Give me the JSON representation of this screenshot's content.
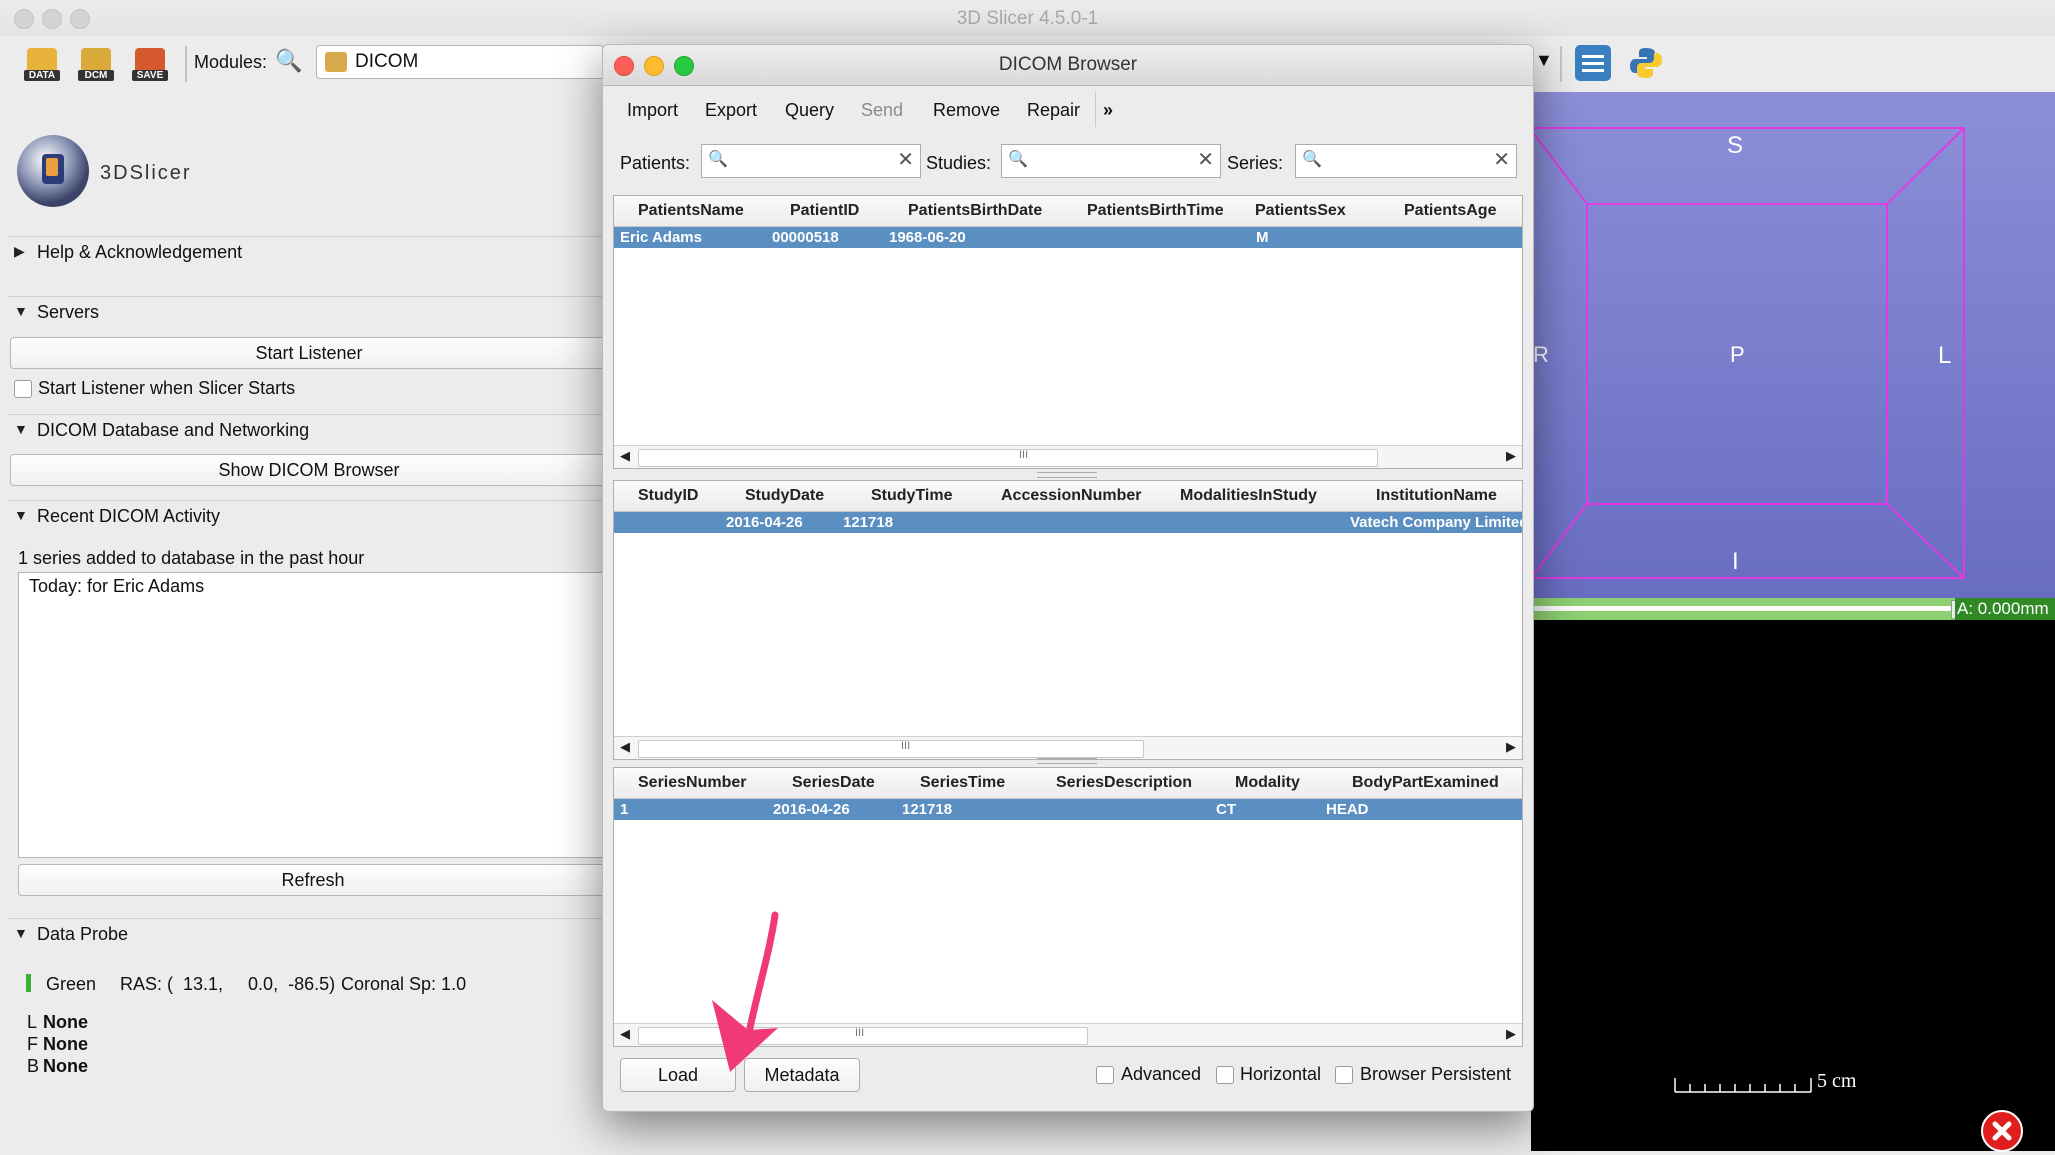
{
  "app": {
    "window_title": "3D Slicer 4.5.0-1"
  },
  "toolbar": {
    "data_label": "DATA",
    "dcm_label": "DCM",
    "save_label": "SAVE",
    "modules_label": "Modules:",
    "module_selected": "DICOM"
  },
  "left": {
    "logo_text": "3DSlicer",
    "help_section": "Help & Acknowledgement",
    "servers_section": "Servers",
    "start_listener": "Start Listener",
    "start_listener_checkbox": "Start Listener when Slicer Starts",
    "db_section": "DICOM Database and Networking",
    "show_browser": "Show DICOM Browser",
    "recent_section": "Recent DICOM Activity",
    "recent_summary": "1 series added to database in the past hour",
    "recent_entry": "Today:  for Eric Adams",
    "refresh": "Refresh",
    "probe_section": "Data Probe",
    "probe_view": "Green",
    "probe_ras": "RAS: (  13.1,     0.0,  -86.5)",
    "probe_orient": "Coronal Sp: 1.0",
    "probe_l_key": "L",
    "probe_l_val": "None",
    "probe_f_key": "F",
    "probe_f_val": "None",
    "probe_b_key": "B",
    "probe_b_val": "None"
  },
  "view3d": {
    "label_s": "S",
    "label_p": "P",
    "label_l": "L",
    "label_r": "R",
    "label_i": "I",
    "slider_readout": "A: 0.000mm",
    "scale_label": "5 cm"
  },
  "dialog": {
    "title": "DICOM Browser",
    "menu": [
      "Import",
      "Export",
      "Query",
      "Send",
      "Remove",
      "Repair",
      "»"
    ],
    "filters": {
      "patients": "Patients:",
      "studies": "Studies:",
      "series": "Series:"
    },
    "patients_table": {
      "headers": [
        "PatientsName",
        "PatientID",
        "PatientsBirthDate",
        "PatientsBirthTime",
        "PatientsSex",
        "PatientsAge"
      ],
      "row": [
        "Eric Adams",
        "00000518",
        "1968-06-20",
        "",
        "M",
        ""
      ]
    },
    "studies_table": {
      "headers": [
        "StudyID",
        "StudyDate",
        "StudyTime",
        "AccessionNumber",
        "ModalitiesInStudy",
        "InstitutionName"
      ],
      "row": [
        "",
        "2016-04-26",
        "121718",
        "",
        "",
        "Vatech Company Limited"
      ]
    },
    "series_table": {
      "headers": [
        "SeriesNumber",
        "SeriesDate",
        "SeriesTime",
        "SeriesDescription",
        "Modality",
        "BodyPartExamined"
      ],
      "row": [
        "1",
        "2016-04-26",
        "121718",
        "",
        "CT",
        "HEAD"
      ]
    },
    "scroll_grip": "III",
    "load": "Load",
    "metadata": "Metadata",
    "advanced": "Advanced",
    "horizontal": "Horizontal",
    "browser_persistent": "Browser Persistent"
  },
  "colors": {
    "selection": "#5b8ec1",
    "view3d_bg": "#7a7ecd",
    "box_outline": "#e03be0",
    "slider_green": "#8ecf71",
    "annotation_arrow": "#f03a78"
  }
}
